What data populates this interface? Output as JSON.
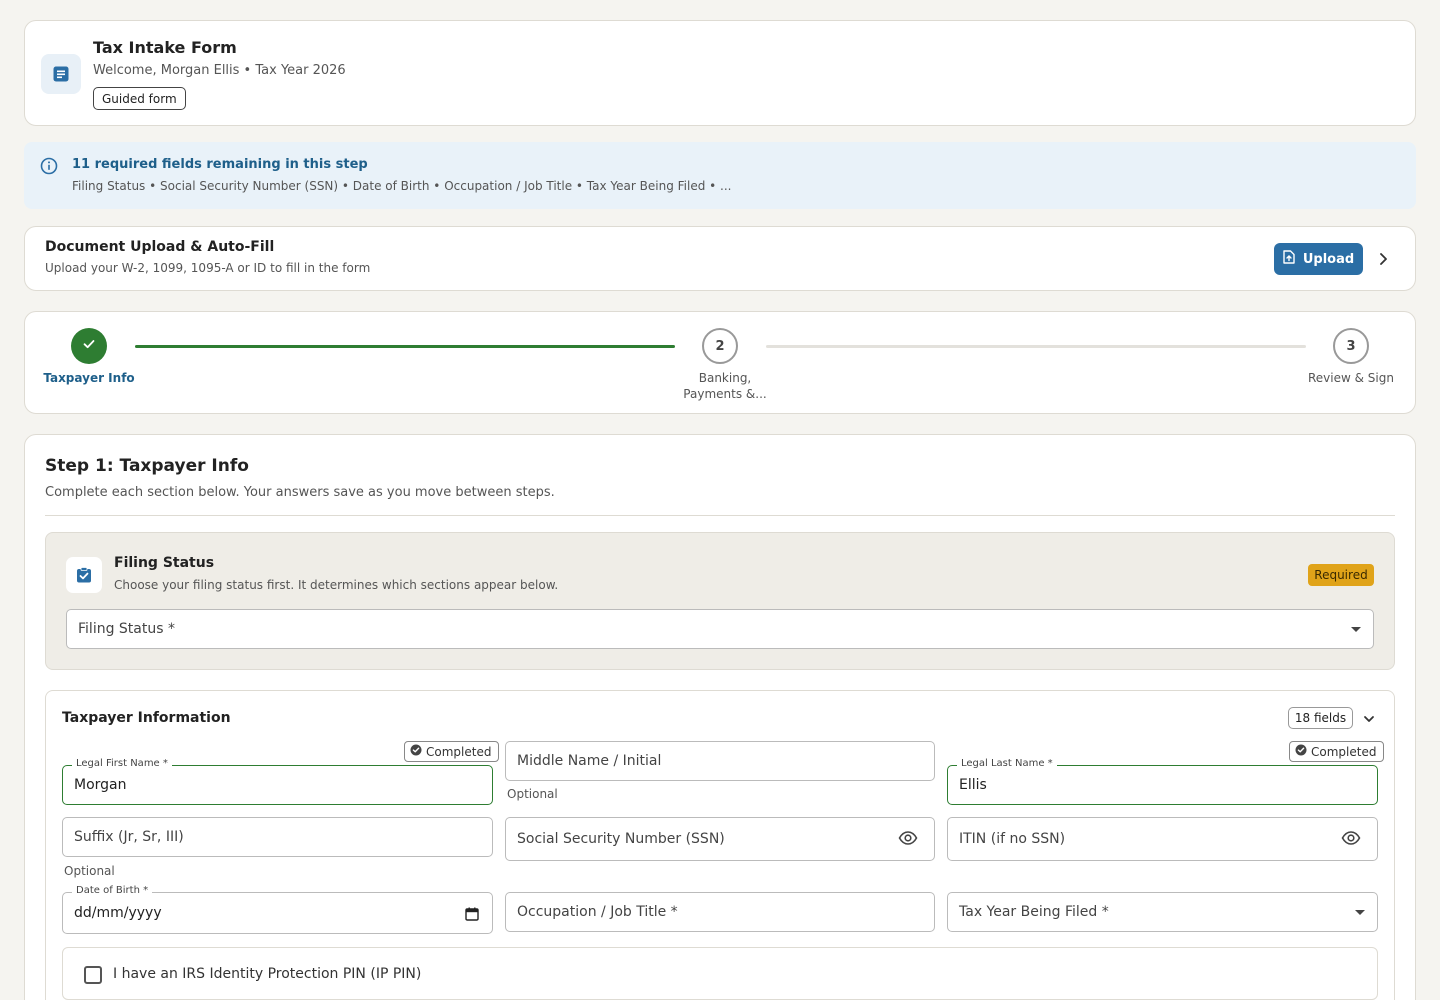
{
  "header": {
    "title": "Tax Intake Form",
    "subtitle": "Welcome, Morgan Ellis • Tax Year 2026",
    "chip": "Guided form"
  },
  "banner": {
    "title": "11 required fields remaining in this step",
    "fields": "Filing Status • Social Security Number (SSN) • Date of Birth • Occupation / Job Title • Tax Year Being Filed • ..."
  },
  "upload": {
    "title": "Document Upload & Auto-Fill",
    "subtitle": "Upload your W-2, 1099, 1095-A or ID to fill in the form",
    "button": "Upload"
  },
  "stepper": {
    "steps": [
      {
        "number": "",
        "label": "Taxpayer Info",
        "status": "completed"
      },
      {
        "number": "2",
        "label": "Banking, Payments &...",
        "status": "pending"
      },
      {
        "number": "3",
        "label": "Review & Sign",
        "status": "pending"
      }
    ]
  },
  "main": {
    "title": "Step 1: Taxpayer Info",
    "subtitle": "Complete each section below. Your answers save as you move between steps."
  },
  "filing_status": {
    "title": "Filing Status",
    "subtitle": "Choose your filing status first. It determines which sections appear below.",
    "badge": "Required",
    "select_placeholder": "Filing Status *"
  },
  "taxpayer": {
    "title": "Taxpayer Information",
    "count": "18 fields",
    "completed_label": "Completed",
    "first_name": {
      "label": "Legal First Name *",
      "value": "Morgan"
    },
    "middle_name": {
      "placeholder": "Middle Name / Initial",
      "hint": "Optional"
    },
    "last_name": {
      "label": "Legal Last Name *",
      "value": "Ellis"
    },
    "suffix": {
      "placeholder": "Suffix (Jr, Sr, III)",
      "hint": "Optional"
    },
    "ssn": {
      "placeholder": "Social Security Number (SSN)"
    },
    "itin": {
      "placeholder": "ITIN (if no SSN)"
    },
    "dob": {
      "label": "Date of Birth *",
      "value": "dd/mm/yyyy"
    },
    "occupation": {
      "placeholder": "Occupation / Job Title *"
    },
    "tax_year": {
      "placeholder": "Tax Year Being Filed *"
    },
    "ip_pin": {
      "label": "I have an IRS Identity Protection PIN (IP PIN)",
      "checked": false
    }
  },
  "colors": {
    "primary": "#2b6ea5",
    "success": "#2e7d32",
    "warning": "#e0a319",
    "background": "#f5f4f0"
  },
  "icons": {
    "header": "document-icon",
    "banner": "info-icon",
    "upload": "file-upload-icon",
    "filing": "clipboard-check-icon",
    "password": "eye-icon",
    "date": "calendar-icon"
  }
}
